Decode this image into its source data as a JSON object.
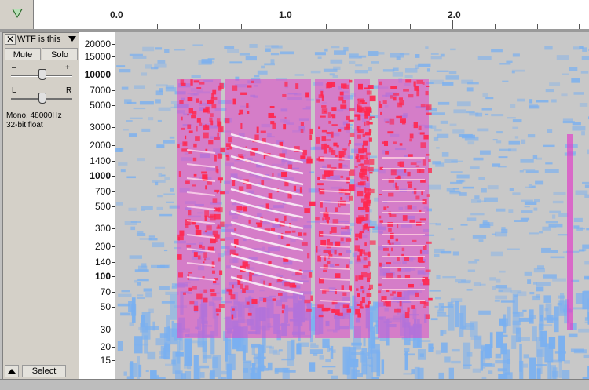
{
  "timeline": {
    "ticks": [
      "0.0",
      "1.0",
      "2.0"
    ]
  },
  "track": {
    "name": "WTF is this",
    "close_label": "✕",
    "mute_label": "Mute",
    "solo_label": "Solo",
    "gain_minus": "–",
    "gain_plus": "+",
    "pan_left": "L",
    "pan_right": "R",
    "gain_level": 0.5,
    "pan_level": 0.5,
    "info_line1": "Mono, 48000Hz",
    "info_line2": "32-bit float",
    "select_label": "Select"
  },
  "vruler": {
    "labels": [
      "20000",
      "15000",
      "10000",
      "7000",
      "5000",
      "3000",
      "2000",
      "1400",
      "1000",
      "700",
      "500",
      "300",
      "200",
      "140",
      "100",
      "70",
      "50",
      "30",
      "20",
      "15"
    ],
    "bold": [
      "10000",
      "1000",
      "100"
    ]
  },
  "colors": {
    "low": "#7ab0f0",
    "mid": "#e040c8",
    "high": "#ff2850",
    "peak": "#ffffff"
  }
}
